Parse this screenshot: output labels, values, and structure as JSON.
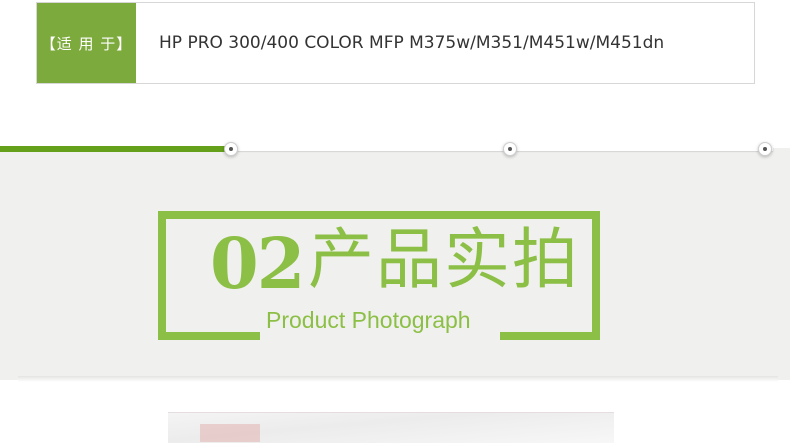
{
  "applies_to": {
    "label": "【适 用 于】",
    "value": "HP PRO 300/400 COLOR MFP M375w/M351/M451w/M451dn"
  },
  "section": {
    "number": "02",
    "title_cn": "产品实拍",
    "title_en": "Product Photograph"
  },
  "colors": {
    "green_accent": "#8cbf45",
    "label_bg": "#7daa3c",
    "timeline_green": "#64a019",
    "band_bg": "#f0f0ee"
  }
}
